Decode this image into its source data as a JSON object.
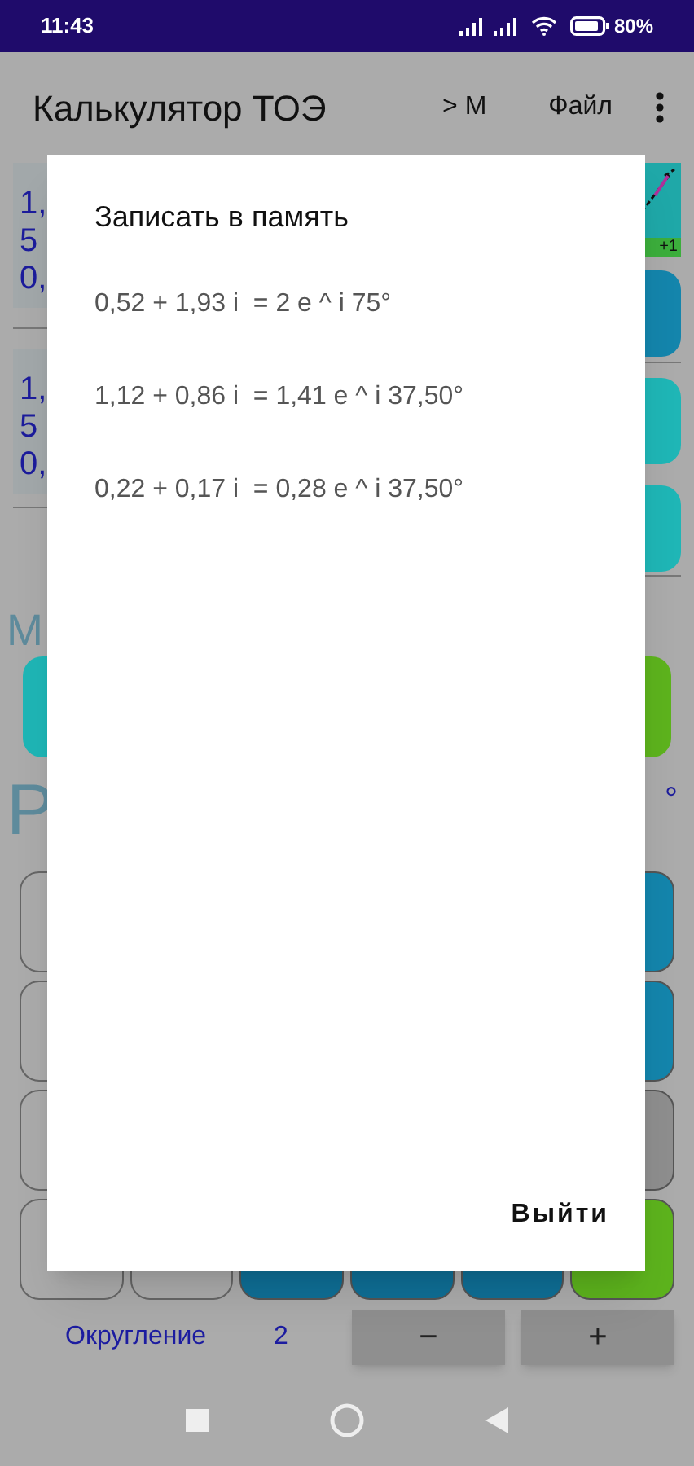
{
  "status_bar": {
    "time": "11:43",
    "battery": "80%"
  },
  "app_bar": {
    "title": "Калькулятор ТОЭ",
    "actions": [
      "> M",
      "Файл"
    ]
  },
  "background": {
    "display_1": [
      "1,",
      "5",
      "0,"
    ],
    "display_2": [
      "1,",
      "5",
      "0,"
    ],
    "graph_label": "+1",
    "memory_label": "М",
    "result_label": "Р",
    "degree_sign": "°"
  },
  "rounding": {
    "label": "Округление",
    "value": "2",
    "buttons": [
      "−",
      "+"
    ]
  },
  "dialog": {
    "title": "Записать в память",
    "items": [
      {
        "text": "0,52 + 1,93 i  = 2 e ^ i 75°"
      },
      {
        "text": "1,12 + 0,86 i  = 1,41 e ^ i 37,50°"
      },
      {
        "text": "0,22 + 0,17 i  = 0,28 e ^ i 37,50°"
      }
    ],
    "button": "Выйти"
  }
}
